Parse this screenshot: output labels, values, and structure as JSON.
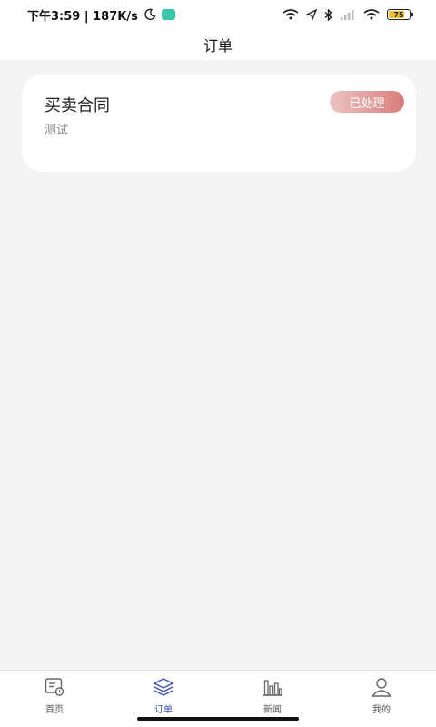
{
  "status_bar": {
    "time_speed": "下午3:59 | 187K/s",
    "battery": "75",
    "icons": [
      "moon-icon",
      "app-notification-icon",
      "wifi-icon",
      "location-icon",
      "bluetooth-icon",
      "signal-icon",
      "wifi-icon",
      "battery-icon"
    ]
  },
  "header": {
    "title": "订单"
  },
  "orders": [
    {
      "title": "买卖合同",
      "subtitle": "测试",
      "status": "已处理"
    }
  ],
  "tabs": [
    {
      "label": "首页",
      "icon": "home-calendar-icon",
      "active": false
    },
    {
      "label": "订单",
      "icon": "layers-icon",
      "active": true
    },
    {
      "label": "新闻",
      "icon": "bar-chart-icon",
      "active": false
    },
    {
      "label": "我的",
      "icon": "user-icon",
      "active": false
    }
  ],
  "colors": {
    "active_tab": "#3b56a8",
    "badge_start": "#eec3c3",
    "badge_end": "#d97c7c",
    "background": "#f4f4f4"
  }
}
